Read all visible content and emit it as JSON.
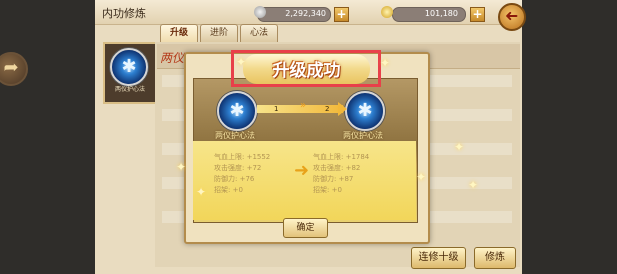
{
  "header": {
    "title": "内功修炼",
    "currency_1": "2,292,340",
    "currency_2": "101,180",
    "plus_symbol": "+",
    "back_symbol": "➜"
  },
  "tabs": [
    {
      "label": "升级",
      "active": true
    },
    {
      "label": "进阶",
      "active": false
    },
    {
      "label": "心法",
      "active": false
    }
  ],
  "left_skill": {
    "name": "两仪护心法"
  },
  "top_row_text": "两仪",
  "dialog": {
    "banner": "升级成功",
    "from_level": "1",
    "to_level": "2",
    "from_skill": "两仪护心法",
    "to_skill": "两仪护心法",
    "before_stats": [
      "气血上限: +1552",
      "攻击强度: +72",
      "防御力: +76",
      "招架: +0"
    ],
    "after_stats": [
      "气血上限: +1784",
      "攻击强度: +82",
      "防御力: +87",
      "招架: +0"
    ],
    "confirm_label": "确定"
  },
  "bottom_buttons": {
    "train_ten": "连修十级",
    "train": "修炼"
  }
}
